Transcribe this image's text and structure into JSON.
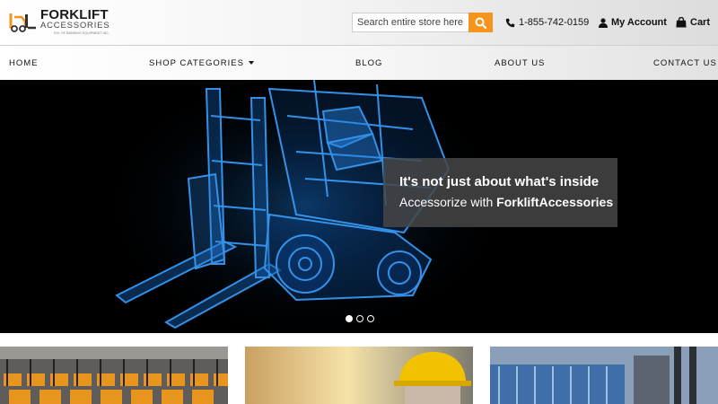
{
  "brand": {
    "title": "FORKLIFT",
    "subtitle": "ACCESSORIES",
    "tagline": "DIV. OF BANNING EQUIPMENT INC.",
    "logo_icon": "forklift-logo-icon",
    "accent_color": "#f7941d"
  },
  "search": {
    "placeholder": "Search entire store here...",
    "button_icon": "search-icon"
  },
  "header": {
    "phone": "1-855-742-0159",
    "account_label": "My Account",
    "cart_label": "Cart"
  },
  "nav": {
    "home": "HOME",
    "shop": "SHOP CATEGORIES",
    "blog": "BLOG",
    "about": "ABOUT US",
    "contact": "CONTACT US"
  },
  "hero": {
    "headline": "It's not just about what's inside",
    "line2_prefix": "Accessorize with ",
    "line2_brand": "ForkliftAccessories",
    "slides": 3,
    "active_slide": 1
  }
}
